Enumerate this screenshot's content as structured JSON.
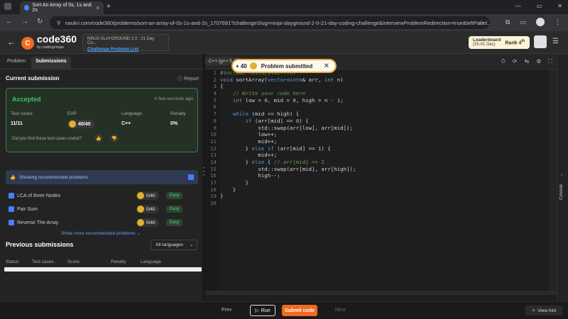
{
  "browser": {
    "tab_title": "Sort An Array of 0s, 1s and 2s",
    "tab_close": "×",
    "new_tab": "+",
    "win_controls": [
      "—",
      "▭",
      "✕"
    ],
    "nav": [
      "←",
      "→",
      "↻",
      "⚲"
    ],
    "url": "naukri.com/code360/problems/sort-an-array-of-0s-1s-and-2s_1707691?challengeSlug=ninja-slayground-2-0-21-day-coding-challenge&interviewProblemRedirection=true&leftPanel...",
    "star": "☆"
  },
  "header": {
    "back": "←",
    "logo_mark": "C",
    "logo_text": "code360",
    "logo_sub": "by codingninjas",
    "challenge_title": "NINJA SLAYGROUND 2.0 : 21 Day Co...",
    "challenge_link": "Challenge Problem List",
    "leaderboard_label": "Leaderboard",
    "leaderboard_date": "(25-01 Dec)",
    "rank_label": "Rank",
    "rank_value": "4",
    "rank_suffix": "th",
    "menu": "☰"
  },
  "left": {
    "tabs": [
      "Problem",
      "Submissions"
    ],
    "current_submission": "Current submission",
    "report": "Report",
    "status": "Accepted",
    "time_ago": "A few seconds ago",
    "cols": {
      "test_cases_label": "Test cases",
      "test_cases_value": "11/11",
      "exp_label": "EXP",
      "exp_value": "40/40",
      "language_label": "Language",
      "language_value": "C++",
      "penalty_label": "Penalty",
      "penalty_value": "0%"
    },
    "useful_q": "Did you find these test cases useful?",
    "thumb_up": "👍",
    "thumb_down": "👎",
    "rec_bar": "Showing recommended problems",
    "problems": [
      {
        "name": "LCA of three Nodes",
        "points": "0/40",
        "difficulty": "Easy"
      },
      {
        "name": "Pair Sum",
        "points": "0/40",
        "difficulty": "Easy"
      },
      {
        "name": "Reverse The Array",
        "points": "0/40",
        "difficulty": "Easy"
      }
    ],
    "show_more": "Show more recommended problems",
    "show_more_chev": "⌄",
    "previous_title": "Previous submissions",
    "lang_filter": "All languages",
    "lang_chev": "⌄",
    "sub_headers": [
      "Status",
      "Test cases",
      "Score",
      "Penalty",
      "Language"
    ]
  },
  "editor": {
    "language": "C++ (g++ 5.4)",
    "tool_icons": [
      "⏱",
      "⟳",
      "⇆",
      "⚙",
      "⛶"
    ],
    "code_lines": [
      {
        "n": "1",
        "text": "#include <bits/stdc++.h>"
      },
      {
        "n": "2",
        "text": "void sortArray(vector<int>& arr, int n)"
      },
      {
        "n": "3",
        "text": "{"
      },
      {
        "n": "4",
        "text": "    // Write your code here"
      },
      {
        "n": "5",
        "text": "    int low = 0, mid = 0, high = n - 1;"
      },
      {
        "n": "6",
        "text": ""
      },
      {
        "n": "7",
        "text": "    while (mid <= high) {"
      },
      {
        "n": "8",
        "text": "        if (arr[mid] == 0) {"
      },
      {
        "n": "9",
        "text": "            std::swap(arr[low], arr[mid]);"
      },
      {
        "n": "10",
        "text": "            low++;"
      },
      {
        "n": "11",
        "text": "            mid++;"
      },
      {
        "n": "12",
        "text": "        } else if (arr[mid] == 1) {"
      },
      {
        "n": "13",
        "text": "            mid++;"
      },
      {
        "n": "14",
        "text": "        } else { // arr[mid] == 2"
      },
      {
        "n": "15",
        "text": "            std::swap(arr[mid], arr[high]);"
      },
      {
        "n": "16",
        "text": "            high--;"
      },
      {
        "n": "17",
        "text": "        }"
      },
      {
        "n": "18",
        "text": "    }"
      },
      {
        "n": "19",
        "text": "}"
      },
      {
        "n": "20",
        "text": ""
      }
    ]
  },
  "toast": {
    "points": "+ 40",
    "message": "Problem submitted",
    "close": "✕"
  },
  "console": {
    "label": "Console",
    "arrow": "‹"
  },
  "footer": {
    "prev": "Prev",
    "run": "Run",
    "run_icon": "▷",
    "submit": "Submit code",
    "next": "Next",
    "hint": "View hint",
    "hint_icon": "✧"
  }
}
